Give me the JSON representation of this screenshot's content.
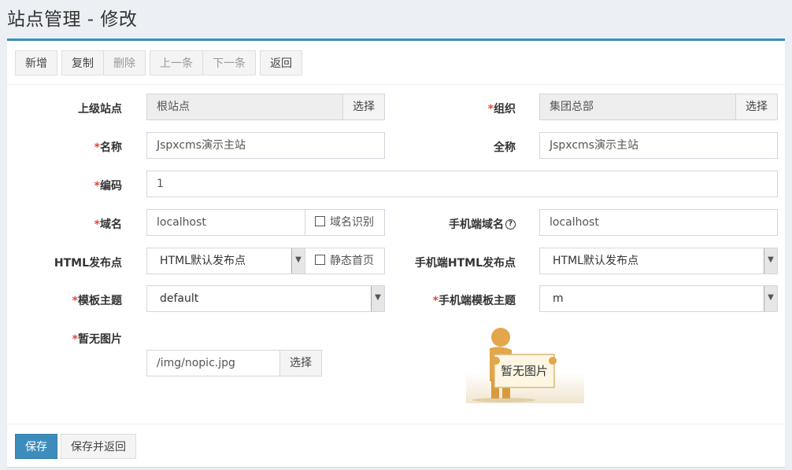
{
  "page": {
    "title": "站点管理 - 修改"
  },
  "toolbar": {
    "new": "新增",
    "copy": "复制",
    "delete": "删除",
    "prev": "上一条",
    "next": "下一条",
    "back": "返回"
  },
  "form": {
    "parent_site": {
      "label": "上级站点",
      "value": "根站点",
      "select": "选择"
    },
    "org": {
      "label": "组织",
      "value": "集团总部",
      "select": "选择"
    },
    "name": {
      "label": "名称",
      "value": "Jspxcms演示主站"
    },
    "full_name": {
      "label": "全称",
      "value": "Jspxcms演示主站"
    },
    "code": {
      "label": "编码",
      "value": "1"
    },
    "domain": {
      "label": "域名",
      "value": "localhost",
      "checkbox": "域名识别"
    },
    "mobile_domain": {
      "label": "手机端域名",
      "value": "localhost"
    },
    "html_publish": {
      "label": "HTML发布点",
      "value": "HTML默认发布点",
      "checkbox": "静态首页"
    },
    "mobile_html_publish": {
      "label": "手机端HTML发布点",
      "value": "HTML默认发布点"
    },
    "theme": {
      "label": "模板主题",
      "value": "default"
    },
    "mobile_theme": {
      "label": "手机端模板主题",
      "value": "m"
    },
    "no_image": {
      "label": "暂无图片",
      "value": "/img/nopic.jpg",
      "select": "选择",
      "preview_text": "暂无图片"
    },
    "required_mark": "*",
    "help_mark": "?"
  },
  "footer": {
    "save": "保存",
    "save_return": "保存并返回"
  },
  "colors": {
    "accent": "#3c8dbc",
    "required": "#dd4b39"
  }
}
